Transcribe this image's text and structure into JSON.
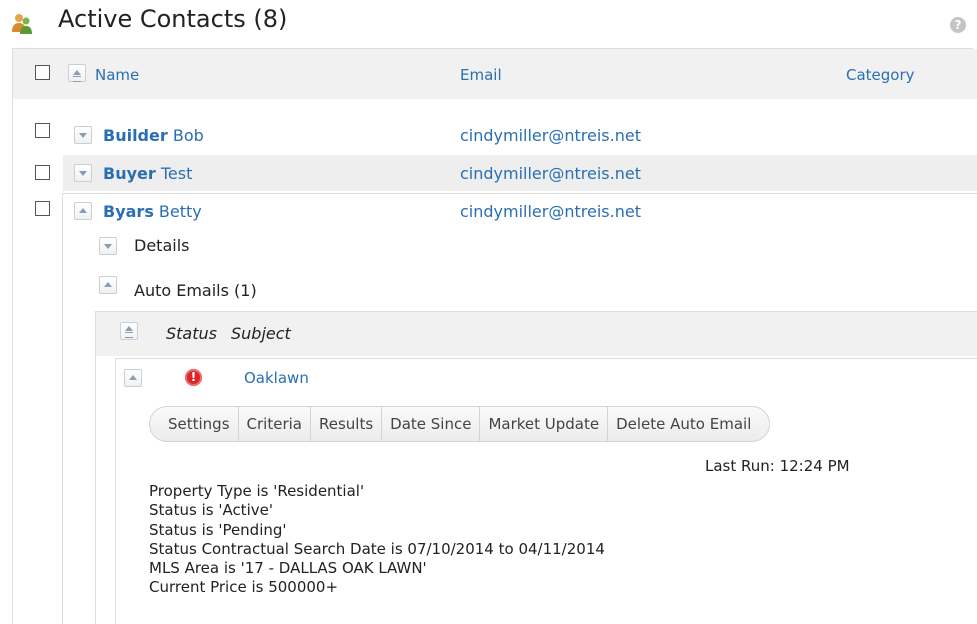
{
  "header": {
    "title": "Active Contacts (8)",
    "help_glyph": "?"
  },
  "columns": {
    "name": "Name",
    "email": "Email",
    "category": "Category"
  },
  "contacts": [
    {
      "first_bold": "Builder",
      "rest": " Bob",
      "email": "cindymiller@ntreis.net"
    },
    {
      "first_bold": "Buyer",
      "rest": " Test",
      "email": "cindymiller@ntreis.net"
    },
    {
      "first_bold": "Byars",
      "rest": " Betty",
      "email": "cindymiller@ntreis.net"
    }
  ],
  "expanded": {
    "details_label": "Details",
    "auto_emails_label": "Auto Emails (1)",
    "sub_columns": {
      "status": "Status",
      "subject": "Subject"
    },
    "auto_email": {
      "subject": "Oaklawn",
      "alert_glyph": "!",
      "actions": [
        "Settings",
        "Criteria",
        "Results",
        "Date Since",
        "Market Update",
        "Delete Auto Email"
      ],
      "last_run": "Last Run: 12:24 PM",
      "criteria": [
        "Property Type is 'Residential'",
        "Status is 'Active'",
        "Status is 'Pending'",
        "Status Contractual Search Date is 07/10/2014 to 04/11/2014",
        "MLS Area is '17 - DALLAS OAK LAWN'",
        "Current Price is 500000+"
      ]
    }
  },
  "colors": {
    "link": "#2a6fb3",
    "header_bg": "#f1f1f1",
    "highlight_row": "#eeeeee",
    "alert": "#d9262a"
  },
  "icons": [
    "contacts-icon",
    "help-icon",
    "alert-icon",
    "sort-icon",
    "expand-icon",
    "collapse-icon"
  ]
}
